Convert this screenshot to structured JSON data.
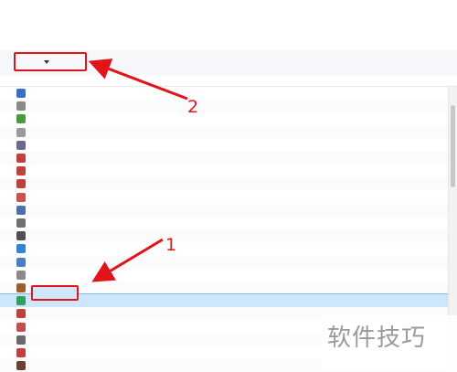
{
  "header": {
    "title": "",
    "description": ""
  },
  "toolbar": {
    "organize_label": "",
    "uninstall_label": ""
  },
  "columns": {
    "name": "",
    "publisher": "",
    "installed_on": ""
  },
  "programs": [
    {
      "name": "",
      "publisher": "",
      "date": "",
      "icon_color": "#3b6fc7"
    },
    {
      "name": "",
      "publisher": "",
      "date": "",
      "icon_color": "#8a8a8a"
    },
    {
      "name": "",
      "publisher": "",
      "date": "",
      "icon_color": "#4a9a3a"
    },
    {
      "name": "",
      "publisher": "",
      "date": "",
      "icon_color": "#9a9a9a"
    },
    {
      "name": "",
      "publisher": "",
      "date": "",
      "icon_color": "#6a6a8a"
    },
    {
      "name": "",
      "publisher": "",
      "date": "",
      "icon_color": "#c04040"
    },
    {
      "name": "",
      "publisher": "",
      "date": "",
      "icon_color": "#c04040"
    },
    {
      "name": "",
      "publisher": "",
      "date": "",
      "icon_color": "#c04040"
    },
    {
      "name": "",
      "publisher": "",
      "date": "",
      "icon_color": "#d05050"
    },
    {
      "name": "",
      "publisher": "",
      "date": "",
      "icon_color": "#4a70b0"
    },
    {
      "name": "",
      "publisher": "",
      "date": "",
      "icon_color": "#707070"
    },
    {
      "name": "",
      "publisher": "",
      "date": "",
      "icon_color": "#505050"
    },
    {
      "name": "",
      "publisher": "",
      "date": "",
      "icon_color": "#2f86d6"
    },
    {
      "name": "",
      "publisher": "",
      "date": "",
      "icon_color": "#4a80c0"
    },
    {
      "name": "",
      "publisher": "",
      "date": "",
      "icon_color": "#8a8a8a"
    },
    {
      "name": "",
      "publisher": "",
      "date": "",
      "icon_color": "#9a6030"
    },
    {
      "name": "",
      "publisher": "",
      "date": "",
      "icon_color": "#2fa060",
      "selected": true
    },
    {
      "name": "",
      "publisher": "",
      "date": "",
      "icon_color": "#c04040"
    },
    {
      "name": "",
      "publisher": "",
      "date": "",
      "icon_color": "#c05050"
    },
    {
      "name": "",
      "publisher": "",
      "date": "",
      "icon_color": "#6a6a6a"
    },
    {
      "name": "",
      "publisher": "",
      "date": "",
      "icon_color": "#c04040"
    },
    {
      "name": "",
      "publisher": "",
      "date": "",
      "icon_color": "#6a4030"
    }
  ],
  "selected_label": "",
  "annotations": {
    "marker_1": "1",
    "marker_2": "2",
    "color": "#e2141a"
  },
  "watermark": "软件技巧"
}
